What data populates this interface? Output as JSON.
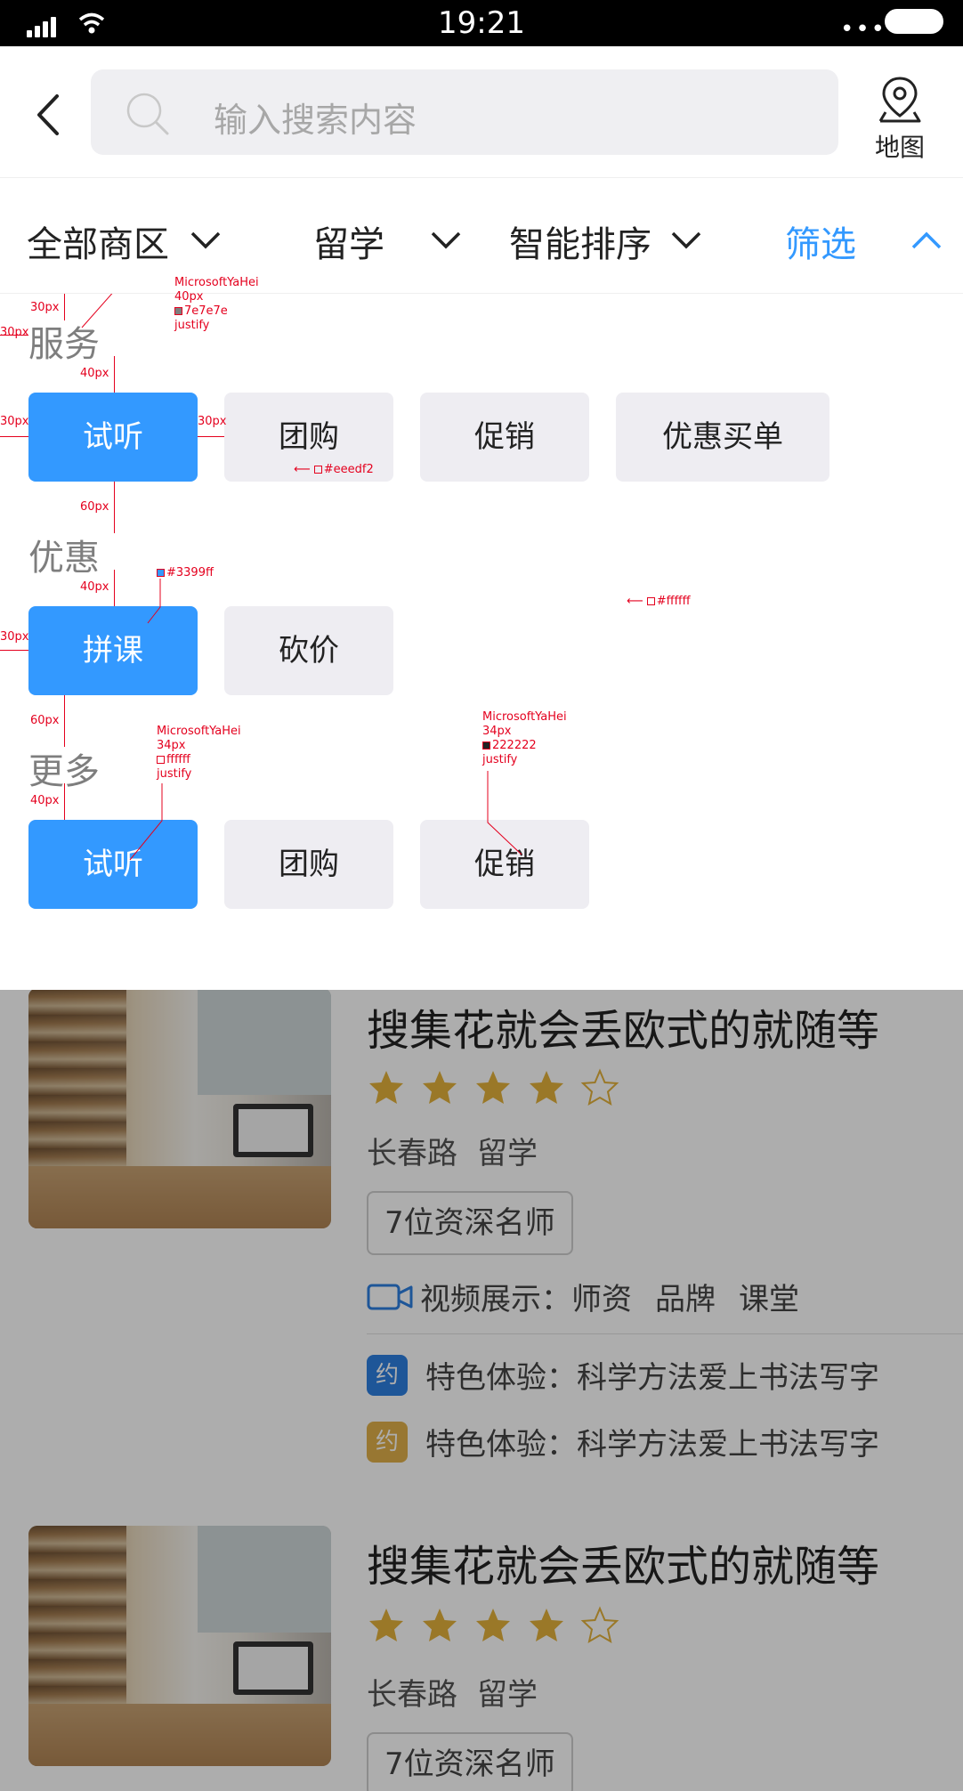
{
  "status_bar": {
    "time": "19:21"
  },
  "header": {
    "search_placeholder": "输入搜索内容",
    "map_label": "地图"
  },
  "filters": [
    {
      "label": "全部商区"
    },
    {
      "label": "留学"
    },
    {
      "label": "智能排序"
    },
    {
      "label": "筛选"
    }
  ],
  "panel": {
    "sections": [
      {
        "title": "服务",
        "chips": [
          "试听",
          "团购",
          "促销",
          "优惠买单"
        ]
      },
      {
        "title": "优惠",
        "chips": [
          "拼课",
          "砍价"
        ]
      },
      {
        "title": "更多",
        "chips": [
          "试听",
          "团购",
          "促销"
        ]
      }
    ],
    "annotations": {
      "spacing_30": "30px",
      "spacing_40": "40px",
      "spacing_60": "60px",
      "title_font": "MicrosoftYaHei",
      "title_size": "40px",
      "title_color": "7e7e7e",
      "align": "justify",
      "chip_bg": "#eeedf2",
      "active_color": "#3399ff",
      "panel_bg": "#ffffff",
      "chip_font": "MicrosoftYaHei",
      "chip_size": "34px",
      "chip_active_text": "ffffff",
      "chip_text": "222222"
    }
  },
  "listings": [
    {
      "title": "搜集花就会丢欧式的就随等",
      "rating": 4,
      "max_rating": 5,
      "location": "长春路",
      "category": "留学",
      "teachers": "7位资深名师",
      "video_label": "视频展示：",
      "video_tags": [
        "师资",
        "品牌",
        "课堂"
      ],
      "promos": [
        {
          "badge": "约",
          "text": "特色体验：科学方法爱上书法写字",
          "color": "#2d7fe0"
        },
        {
          "badge": "约",
          "text": "特色体验：科学方法爱上书法写字",
          "color": "#e0b04a"
        }
      ]
    },
    {
      "title": "搜集花就会丢欧式的就随等",
      "rating": 4,
      "max_rating": 5,
      "location": "长春路",
      "category": "留学",
      "teachers": "7位资深名师"
    }
  ],
  "colors": {
    "accent": "#3399ff",
    "star": "#e3b23c",
    "chip_bg": "#eeedf2"
  }
}
